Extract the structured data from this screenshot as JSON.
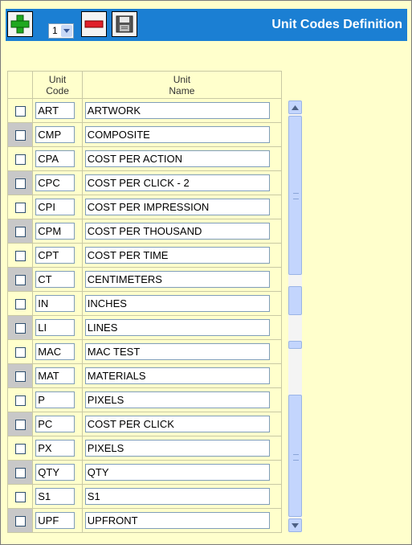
{
  "header": {
    "title": "Unit Codes Definition",
    "page_select_value": "1",
    "add_icon": "plus-icon",
    "delete_icon": "minus-icon",
    "save_icon": "save-icon"
  },
  "grid": {
    "columns": {
      "code_line1": "Unit",
      "code_line2": "Code",
      "name_line1": "Unit",
      "name_line2": "Name"
    },
    "rows": [
      {
        "code": "ART",
        "name": "ARTWORK"
      },
      {
        "code": "CMP",
        "name": "COMPOSITE"
      },
      {
        "code": "CPA",
        "name": "COST PER ACTION"
      },
      {
        "code": "CPC",
        "name": "COST PER CLICK - 2"
      },
      {
        "code": "CPI",
        "name": "COST PER IMPRESSION"
      },
      {
        "code": "CPM",
        "name": "COST PER THOUSAND"
      },
      {
        "code": "CPT",
        "name": "COST PER TIME"
      },
      {
        "code": "CT",
        "name": "CENTIMETERS"
      },
      {
        "code": "IN",
        "name": "INCHES"
      },
      {
        "code": "LI",
        "name": "LINES"
      },
      {
        "code": "MAC",
        "name": "MAC TEST"
      },
      {
        "code": "MAT",
        "name": "MATERIALS"
      },
      {
        "code": "P",
        "name": "PIXELS"
      },
      {
        "code": "PC",
        "name": "COST PER CLICK"
      },
      {
        "code": "PX",
        "name": "PIXELS"
      },
      {
        "code": "QTY",
        "name": "QTY"
      },
      {
        "code": "S1",
        "name": "S1"
      },
      {
        "code": "UPF",
        "name": "UPFRONT"
      }
    ]
  },
  "colors": {
    "background": "#ffffcc",
    "toolbar": "#1b7fd3",
    "alt_row_cell": "#c8c8c8"
  }
}
